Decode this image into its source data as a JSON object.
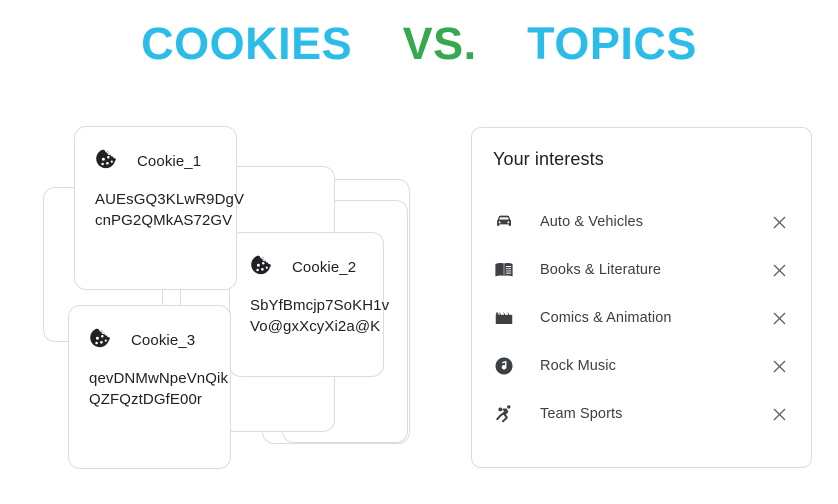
{
  "title": {
    "left": "COOKIES",
    "middle": "VS.",
    "right": "TOPICS",
    "left_color": "#2CBCE8",
    "middle_color": "#36A84F",
    "right_color": "#2CBCE8"
  },
  "cookies": {
    "icon": "cookie-icon",
    "cards": [
      {
        "name": "Cookie_1",
        "line1": "AUEsGQ3KLwR9DgV",
        "line2": "cnPG2QMkAS72GV"
      },
      {
        "name": "Cookie_2",
        "line1": "SbYfBmcjp7SoKH1v",
        "line2": "Vo@gxXcyXi2a@K"
      },
      {
        "name": "Cookie_3",
        "line1": "qevDNMwNpeVnQik",
        "line2": "QZFQztDGfE00r"
      }
    ]
  },
  "interests": {
    "heading": "Your interests",
    "remove_icon": "close-icon",
    "items": [
      {
        "label": "Auto & Vehicles",
        "icon": "car-icon"
      },
      {
        "label": "Books & Literature",
        "icon": "book-icon"
      },
      {
        "label": "Comics & Animation",
        "icon": "clapperboard-icon"
      },
      {
        "label": "Rock Music",
        "icon": "music-note-icon"
      },
      {
        "label": "Team Sports",
        "icon": "sports-person-icon"
      }
    ]
  },
  "colors": {
    "card_border": "#dadce0",
    "text_primary": "#202124",
    "text_secondary": "#3c4043",
    "icon_dark": "#202124",
    "close_gray": "#5f6368",
    "background": "#ffffff"
  }
}
